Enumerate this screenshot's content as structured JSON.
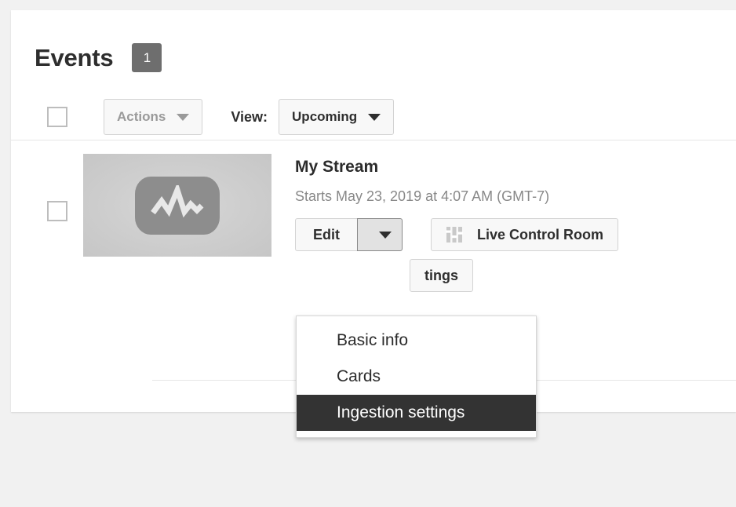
{
  "page": {
    "title": "Events",
    "count_badge": "1",
    "background_color": "#f1f1f1",
    "card_color": "#ffffff"
  },
  "toolbar": {
    "select_all_checkbox": "unchecked",
    "actions_label": "Actions",
    "actions_disabled": true,
    "view_label": "View:",
    "view_value": "Upcoming",
    "view_options": [
      "Upcoming"
    ]
  },
  "events": [
    {
      "title": "My Stream",
      "schedule": "Starts May 23, 2019 at 4:07 AM (GMT-7)",
      "checkbox": "unchecked",
      "thumbnail_icon": "live-waveform-icon",
      "edit_label": "Edit",
      "edit_caret_expanded": true,
      "live_control_room_label": "Live Control Room",
      "live_control_room_icon": "mixer-equalizer-icon",
      "secondary_button_label": "tings"
    }
  ],
  "edit_menu": {
    "items": [
      {
        "label": "Basic info",
        "selected": false
      },
      {
        "label": "Cards",
        "selected": false
      },
      {
        "label": "Ingestion settings",
        "selected": true
      }
    ],
    "highlight_color": "#333333"
  }
}
